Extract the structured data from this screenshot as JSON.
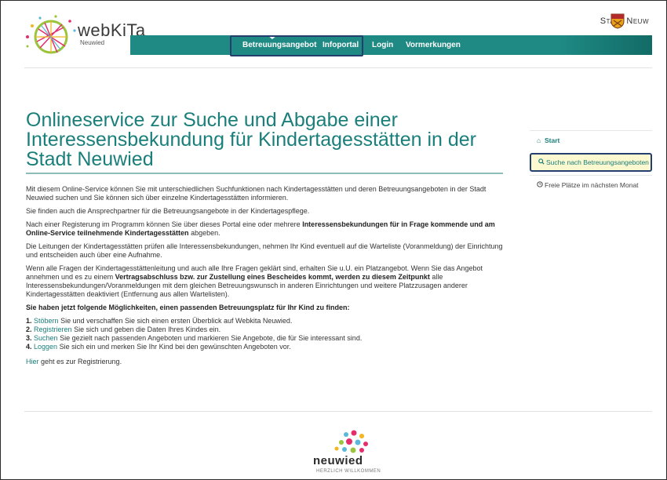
{
  "header": {
    "logo_text": "webKiTa",
    "logo_sub": "Neuwied",
    "stadt_label": "Stadt Neuw",
    "nav": [
      {
        "label": "Betreuungsangebot"
      },
      {
        "label": "Infoportal"
      },
      {
        "label": "Login"
      },
      {
        "label": "Vormerkungen"
      }
    ]
  },
  "main": {
    "title": "Onlineservice zur Suche und Abgabe einer Interessensbekundung für Kindertagesstätten in der Stadt Neuwied",
    "p1": "Mit diesem Online-Service können Sie mit unterschiedlichen Suchfunktionen nach Kindertagesstätten und deren Betreuungsangeboten in der Stadt Neuwied suchen und Sie können sich über einzelne Kindertagesstätten informieren.",
    "p2": "Sie finden auch die Ansprechpartner für die Betreuungsangebote in der Kindertagespflege.",
    "p3_a": "Nach einer Registerung im Programm können Sie über dieses Portal eine oder mehrere ",
    "p3_b": "Interessensbekundungen für in Frage kommende und am Online-Service teilnehmende Kindertagesstätten",
    "p3_c": " abgeben.",
    "p4": "Die Leitungen der Kindertagesstätten prüfen alle Interessensbekundungen, nehmen Ihr Kind eventuell auf die Warteliste (Voranmeldung) der Einrichtung und entscheiden auch über eine Aufnahme.",
    "p5_a": "Wenn alle Fragen der Kindertagesstättenleitung und auch alle Ihre Fragen geklärt sind, erhalten Sie u.U. ein Platzangebot. Wenn Sie das Angebot annehmen und es zu einem ",
    "p5_b": "Vertragsabschluss bzw. zur Zustellung eines Bescheides kommt, werden zu diesem Zeitpunkt",
    "p5_c": " alle Interessensbekundungen/Voranmeldungen mit dem gleichen Betreuungswunsch in anderen Einrichtungen und weitere Platzzusagen anderer Kindertagesstätten deaktiviert (Entfernung aus allen Wartelisten).",
    "possibilities_heading": "Sie haben jetzt folgende Möglichkeiten, einen passenden Betreuungsplatz für Ihr Kind zu finden:",
    "steps": [
      {
        "num": "1.",
        "link": "Stöbern",
        "text": " Sie und verschaffen Sie sich einen ersten Überblick auf Webkita Neuwied."
      },
      {
        "num": "2.",
        "link": "Registrieren",
        "text": " Sie sich und geben die Daten Ihres Kindes ein."
      },
      {
        "num": "3.",
        "link": "Suchen",
        "text": " Sie gezielt nach passenden Angeboten und markieren Sie Angebote, die für Sie interessant sind."
      },
      {
        "num": "4.",
        "link": "Loggen",
        "text": " Sie sich ein und merken Sie Ihr Kind bei den gewünschten Angeboten vor."
      }
    ],
    "reg_link": "Hier",
    "reg_text": " geht es zur Registrierung."
  },
  "sidebar": {
    "items": [
      {
        "label": "Start",
        "icon": "home-icon"
      },
      {
        "label": "Suche nach Betreuungsangeboten",
        "icon": "search-icon"
      },
      {
        "label": "Freie Plätze im nächsten Monat",
        "icon": "clock-icon"
      }
    ]
  },
  "footer": {
    "name": "neuwied",
    "tagline": "HERZLICH WILLKOMMEN"
  },
  "colors": {
    "nav_bg": "#1f8a84",
    "accent": "#1a7f7b",
    "highlight_border": "#243f6e",
    "active_bg": "#fcf8d0"
  }
}
